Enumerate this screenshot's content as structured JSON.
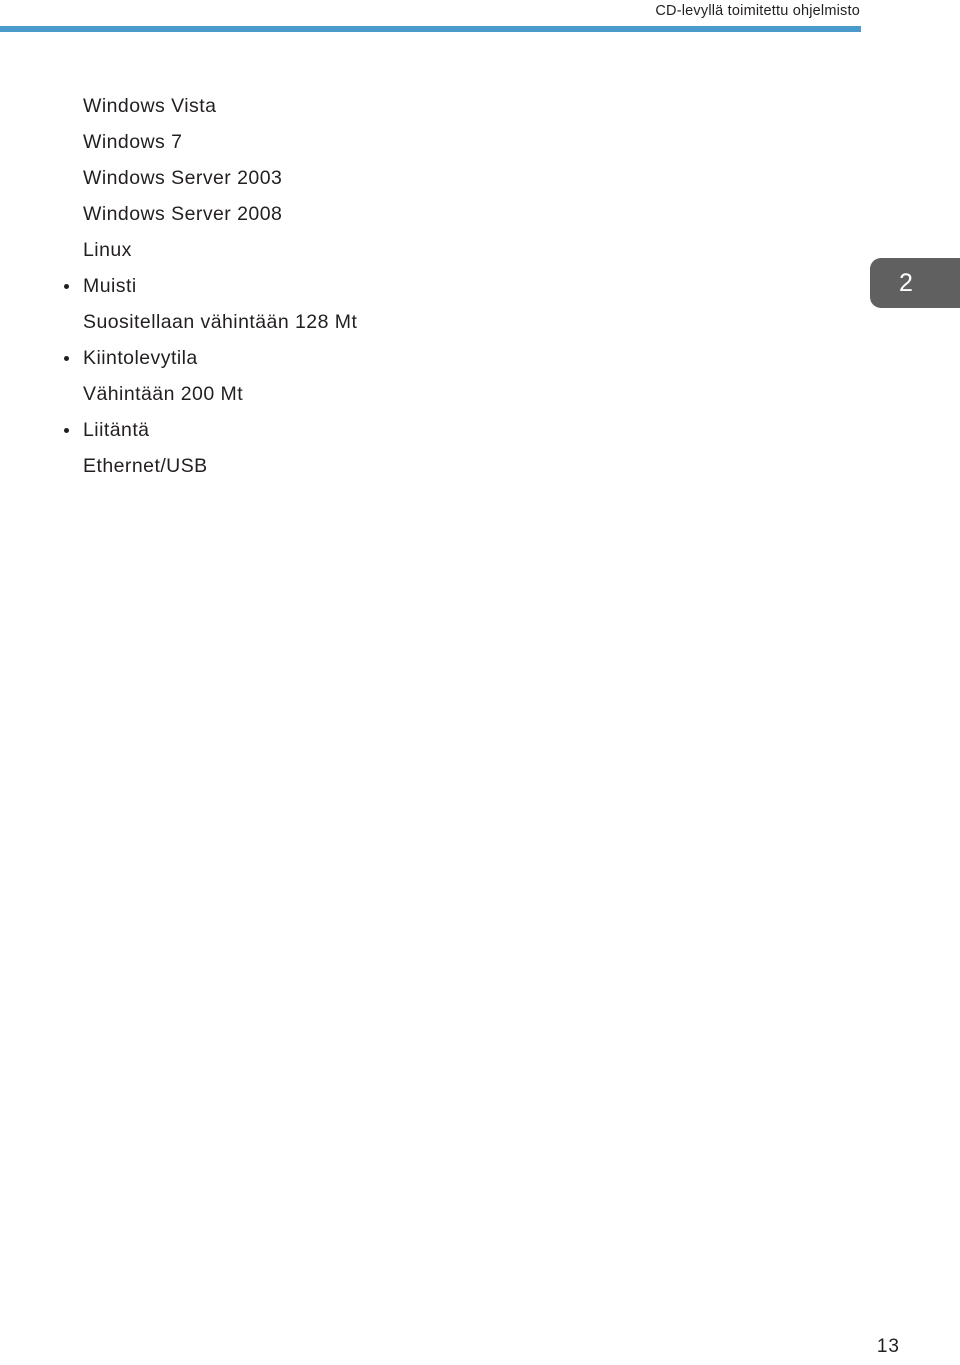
{
  "header": {
    "title": "CD-levyllä toimitettu ohjelmisto",
    "rule_color": "#4a9acb"
  },
  "content": {
    "lines": [
      {
        "text": "Windows Vista",
        "bulleted": false
      },
      {
        "text": "Windows 7",
        "bulleted": false
      },
      {
        "text": "Windows Server 2003",
        "bulleted": false
      },
      {
        "text": "Windows Server 2008",
        "bulleted": false
      },
      {
        "text": "Linux",
        "bulleted": false
      },
      {
        "text": "Muisti",
        "bulleted": true
      },
      {
        "text": "Suositellaan vähintään 128 Mt",
        "bulleted": false
      },
      {
        "text": "Kiintolevytila",
        "bulleted": true
      },
      {
        "text": "Vähintään 200 Mt",
        "bulleted": false
      },
      {
        "text": "Liitäntä",
        "bulleted": true
      },
      {
        "text": "Ethernet/USB",
        "bulleted": false
      }
    ]
  },
  "chapter_tab": {
    "number": "2",
    "background_color": "#606060",
    "text_color": "#ffffff"
  },
  "footer": {
    "page_number": "13"
  }
}
